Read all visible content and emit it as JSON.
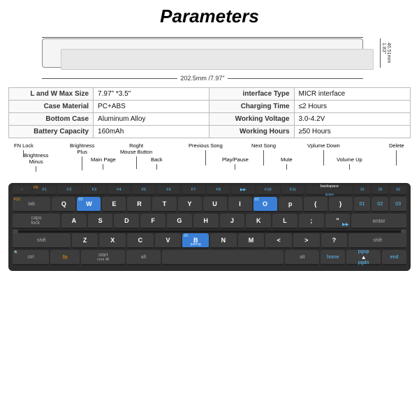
{
  "title": "Parameters",
  "device": {
    "width_label": "202.5mm /7.97\"",
    "height_label": "46.51mm",
    "height_label2": "1.83\""
  },
  "params": [
    {
      "label": "L and W Max Size",
      "value": "7.97\" *3.5\"",
      "label2": "interface Type",
      "value2": "MICR interface"
    },
    {
      "label": "Case Material",
      "value": "PC+ABS",
      "label2": "Charging Time",
      "value2": "≤2 Hours"
    },
    {
      "label": "Bottom Case",
      "value": "Aluminum Alloy",
      "label2": "Working Voltage",
      "value2": "3.0-4.2V"
    },
    {
      "label": "Battery Capacity",
      "value": "160mAh",
      "label2": "Working Hours",
      "value2": "≥50 Hours"
    }
  ],
  "key_labels": {
    "fn_lock": "FN Lock",
    "brightness_plus": "Brightness\nPlus",
    "brightness_minus": "Brightness\nMinus",
    "right_mouse": "Roght\nMouse Button",
    "main_page": "Main Page",
    "back": "Back",
    "previous_song": "Previous Song",
    "play_pause": "Play/Pause",
    "next_song": "Next Song",
    "mute": "Mute",
    "volume_down": "Vplume Down",
    "volume_up": "Volume Up",
    "delete": "Delete"
  },
  "keyboard": {
    "rows": []
  }
}
